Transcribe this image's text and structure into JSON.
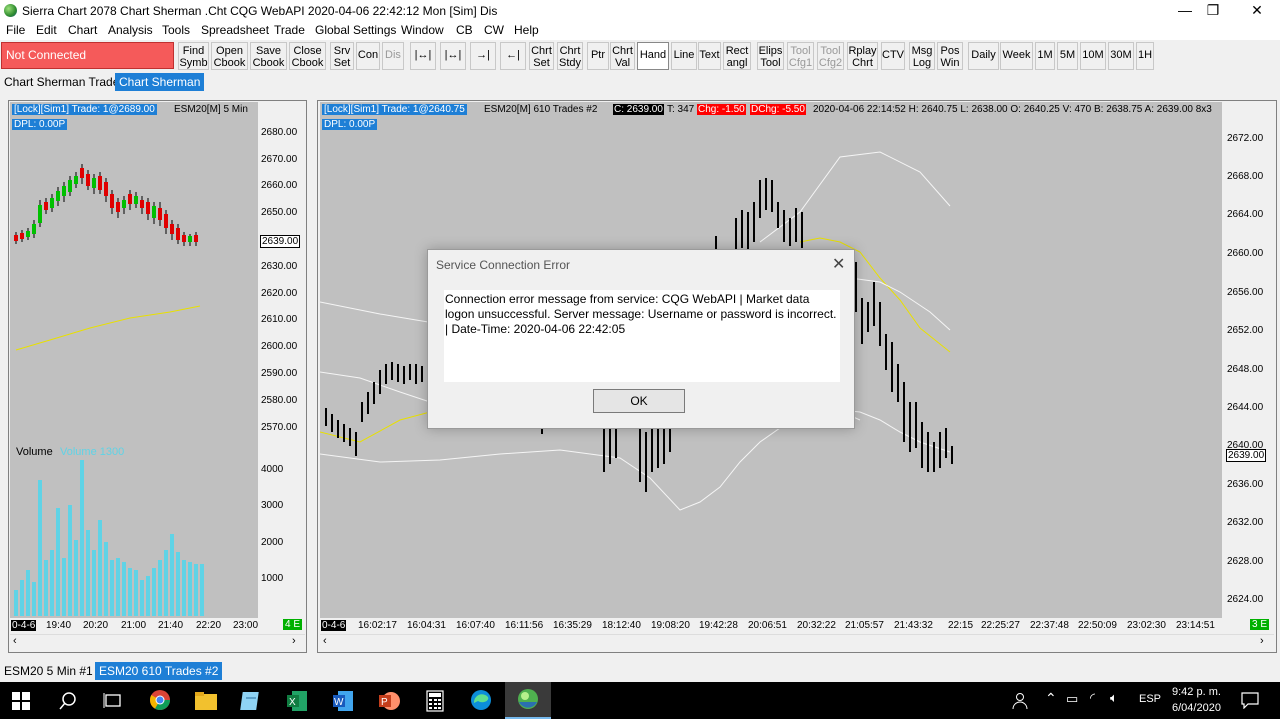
{
  "window": {
    "title": "Sierra Chart 2078 Chart Sherman .Cht  CQG WebAPI 2020-04-06  22:42:12 Mon [Sim]  Dis",
    "minimize": "—",
    "maximize": "❐",
    "close": "✕"
  },
  "menu": [
    "File",
    "Edit",
    "Chart",
    "Analysis",
    "Tools",
    "Spreadsheet",
    "Trade",
    "Global Settings",
    "Window",
    "CB",
    "CW",
    "Help"
  ],
  "toolbar": {
    "status": "Not Connected",
    "buttons": [
      {
        "l1": "Find",
        "l2": "Symb"
      },
      {
        "l1": "Open",
        "l2": "Cbook"
      },
      {
        "l1": "Save",
        "l2": "Cbook"
      },
      {
        "l1": "Close",
        "l2": "Cbook"
      },
      {
        "l1": "Srv",
        "l2": "Set"
      },
      {
        "l1": "Con",
        "l2": ""
      },
      {
        "l1": "Dis",
        "l2": ""
      },
      {
        "l1": "Chrt",
        "l2": "Set"
      },
      {
        "l1": "Chrt",
        "l2": "Stdy"
      },
      {
        "l1": "Ptr",
        "l2": ""
      },
      {
        "l1": "Chrt",
        "l2": "Val"
      },
      {
        "l1": "Hand",
        "l2": ""
      },
      {
        "l1": "Line",
        "l2": ""
      },
      {
        "l1": "Text",
        "l2": ""
      },
      {
        "l1": "Rect",
        "l2": "angl"
      },
      {
        "l1": "Elips",
        "l2": "Tool"
      },
      {
        "l1": "Tool",
        "l2": "Cfg1"
      },
      {
        "l1": "Tool",
        "l2": "Cfg2"
      },
      {
        "l1": "Rplay",
        "l2": "Chrt"
      },
      {
        "l1": "CTV",
        "l2": ""
      },
      {
        "l1": "Msg",
        "l2": "Log"
      },
      {
        "l1": "Pos",
        "l2": "Win"
      },
      {
        "l1": "Daily",
        "l2": ""
      },
      {
        "l1": "Week",
        "l2": ""
      },
      {
        "l1": "1M",
        "l2": ""
      },
      {
        "l1": "5M",
        "l2": ""
      },
      {
        "l1": "10M",
        "l2": ""
      },
      {
        "l1": "30M",
        "l2": ""
      },
      {
        "l1": "1H",
        "l2": ""
      }
    ]
  },
  "tabs": [
    "Chart Sherman Trader",
    "Chart Sherman"
  ],
  "left_chart": {
    "header": "[Lock][Sim1]  Trade: 1@2689.00",
    "symbol": "ESM20[M]  5 Min",
    "dpl": "DPL: 0.00P",
    "price_labels": [
      "2680.00",
      "2670.00",
      "2660.00",
      "2650.00",
      "2639.00",
      "2630.00",
      "2620.00",
      "2610.00",
      "2600.00",
      "2590.00",
      "2580.00",
      "2570.00"
    ],
    "volume_title": "Volume",
    "volume_value": "Volume 1300",
    "volume_labels": [
      "4000",
      "3000",
      "2000",
      "1000"
    ],
    "time_labels": [
      "0-4-6",
      "19:40",
      "20:20",
      "21:00",
      "21:40",
      "22:20",
      "23:00"
    ],
    "corner_badge": "4 E"
  },
  "main_chart": {
    "header": "[Lock][Sim1]  Trade: 1@2640.75",
    "symbol": "ESM20[M]  610 Trades  #2",
    "close": "C: 2639.00",
    "ticks": "T: 347",
    "chg": "Chg: -1.50",
    "dchg": "DChg: -5.50",
    "info": "2020-04-06 22:14:52 H: 2640.75 L: 2638.00 O: 2640.25 V: 470 B: 2638.75 A: 2639.00 8x3",
    "dpl": "DPL: 0.00P",
    "price_labels": [
      "2672.00",
      "2668.00",
      "2664.00",
      "2660.00",
      "2656.00",
      "2652.00",
      "2648.00",
      "2644.00",
      "2640.00",
      "2639.00",
      "2636.00",
      "2632.00",
      "2628.00",
      "2624.00"
    ],
    "time_labels": [
      "0-4-6",
      "16:02:17",
      "16:04:31",
      "16:07:40",
      "16:11:56",
      "16:35:29",
      "18:12:40",
      "19:08:20",
      "19:42:28",
      "20:06:51",
      "20:32:22",
      "21:05:57",
      "21:43:32",
      "22:15",
      "22:25:27",
      "22:37:48",
      "22:50:09",
      "23:02:30",
      "23:14:51"
    ],
    "corner_badge": "3 E"
  },
  "dialog": {
    "title": "Service Connection Error",
    "message": "Connection error message from service: CQG WebAPI | Market data logon unsuccessful. Server message: Username or password is incorrect. | Date-Time: 2020-04-06  22:42:05",
    "ok": "OK",
    "close": "✕"
  },
  "bottom_tabs": [
    "ESM20  5 Min  #1",
    "ESM20  610 Trades  #2"
  ],
  "taskbar": {
    "lang": "ESP",
    "time": "9:42 p. m.",
    "date": "6/04/2020"
  },
  "colors": {
    "accent": "#1e7fd6",
    "error": "#f55a5a",
    "chart_bg": "#c0c0c0",
    "volume": "#5fd3e6"
  }
}
